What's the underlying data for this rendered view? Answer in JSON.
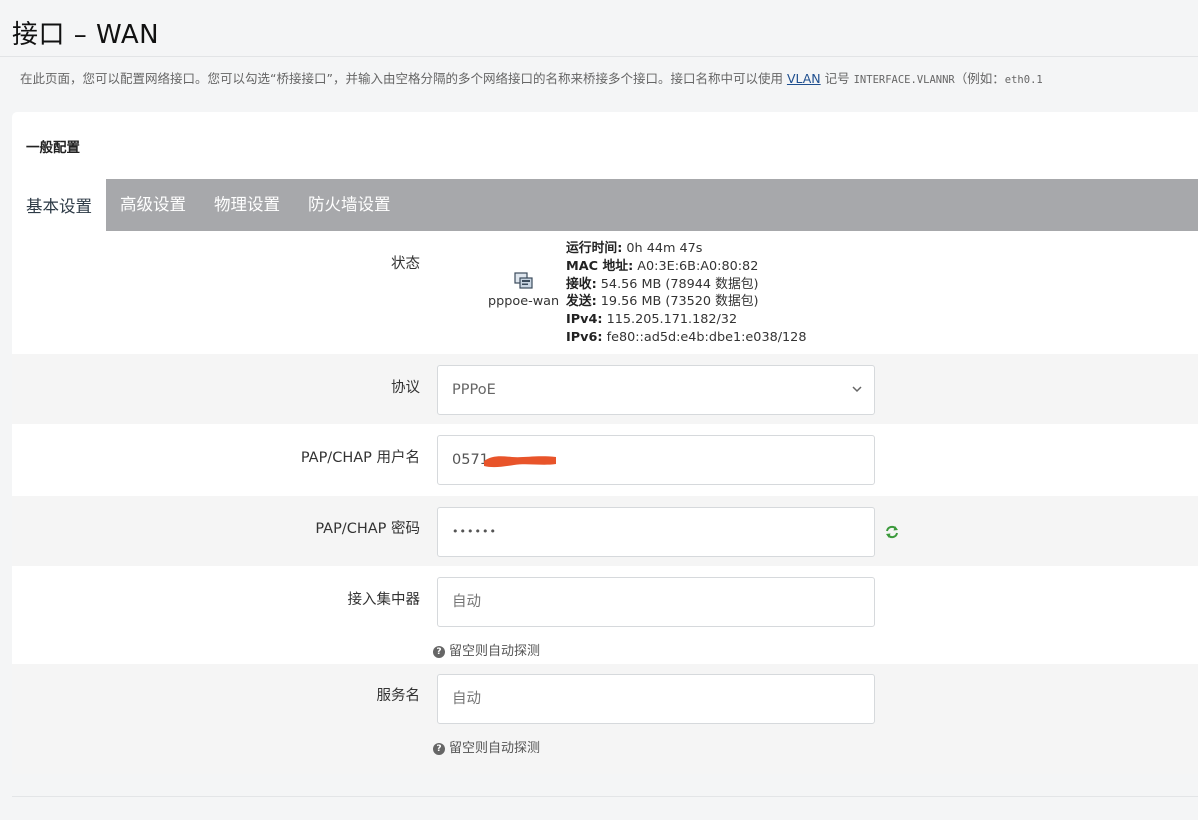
{
  "page": {
    "title": "接口 – WAN",
    "desc_before": "在此页面，您可以配置网络接口。您可以勾选“桥接接口”，并输入由空格分隔的多个网络接口的名称来桥接多个接口。接口名称中可以使用 ",
    "desc_link": "VLAN",
    "desc_middle": " 记号 ",
    "desc_code": "INTERFACE.VLANNR",
    "desc_after": "（例如：",
    "desc_code2": "eth0.1"
  },
  "section": {
    "title": "一般配置"
  },
  "tabs": [
    {
      "label": "基本设置",
      "active": true
    },
    {
      "label": "高级设置",
      "active": false
    },
    {
      "label": "物理设置",
      "active": false
    },
    {
      "label": "防火墙设置",
      "active": false
    }
  ],
  "status": {
    "label": "状态",
    "interface_name": "pppoe-wan",
    "icon": "network-interface-icon",
    "uptime_key": "运行时间:",
    "uptime_value": " 0h 44m 47s",
    "mac_key": "MAC 地址:",
    "mac_value": " A0:3E:6B:A0:80:82",
    "rx_key": "接收:",
    "rx_value": " 54.56 MB (78944 数据包)",
    "tx_key": "发送:",
    "tx_value": " 19.56 MB (73520 数据包)",
    "ipv4_key": "IPv4:",
    "ipv4_value": " 115.205.171.182/32",
    "ipv6_key": "IPv6:",
    "ipv6_value": " fe80::ad5d:e4b:dbe1:e038/128"
  },
  "protocol": {
    "label": "协议",
    "selected": "PPPoE"
  },
  "username": {
    "label": "PAP/CHAP 用户名",
    "value": "0571"
  },
  "password": {
    "label": "PAP/CHAP 密码",
    "value": "••••••",
    "reveal_icon": "refresh-reveal-icon"
  },
  "concentrator": {
    "label": "接入集中器",
    "placeholder": "自动",
    "help": "留空则自动探测"
  },
  "service": {
    "label": "服务名",
    "placeholder": "自动",
    "help": "留空则自动探测"
  },
  "colors": {
    "tab_bar": "#a7a8ab",
    "link": "#1f4f8f",
    "redaction": "#e8542a",
    "reveal_icon": "#3c9a3c"
  }
}
